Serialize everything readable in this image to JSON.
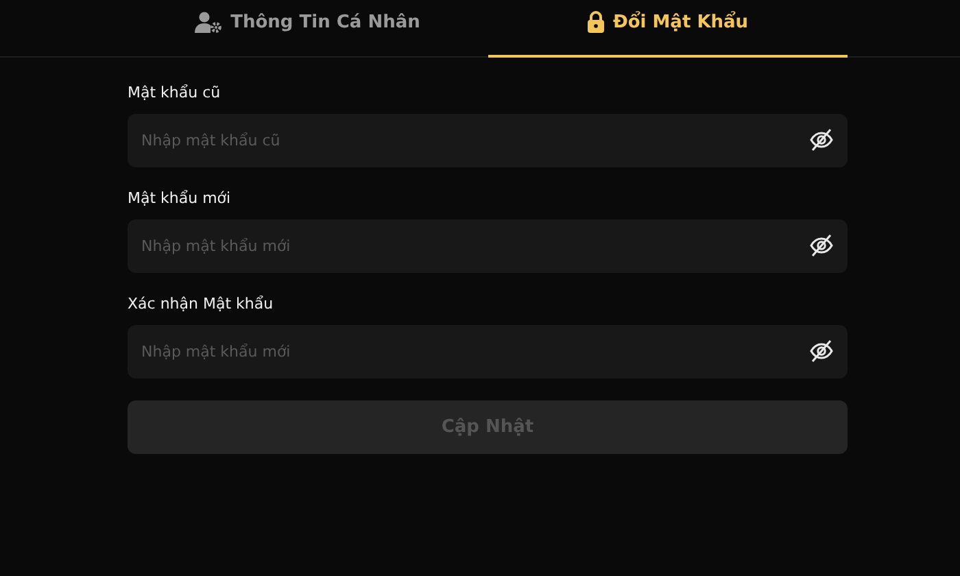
{
  "tabs": [
    {
      "kind": "profile",
      "label": "Thông Tin Cá Nhân",
      "selected": false
    },
    {
      "kind": "password",
      "label": "Đổi Mật Khẩu",
      "selected": true
    }
  ],
  "fields": [
    {
      "label": "Mật khẩu cũ",
      "placeholder": "Nhập mật khẩu cũ"
    },
    {
      "label": "Mật khẩu mới",
      "placeholder": "Nhập mật khẩu mới"
    },
    {
      "label": "Xác nhận Mật khẩu",
      "placeholder": "Nhập mật khẩu mới"
    }
  ],
  "submit": {
    "label": "Cập Nhật",
    "disabled": true
  }
}
